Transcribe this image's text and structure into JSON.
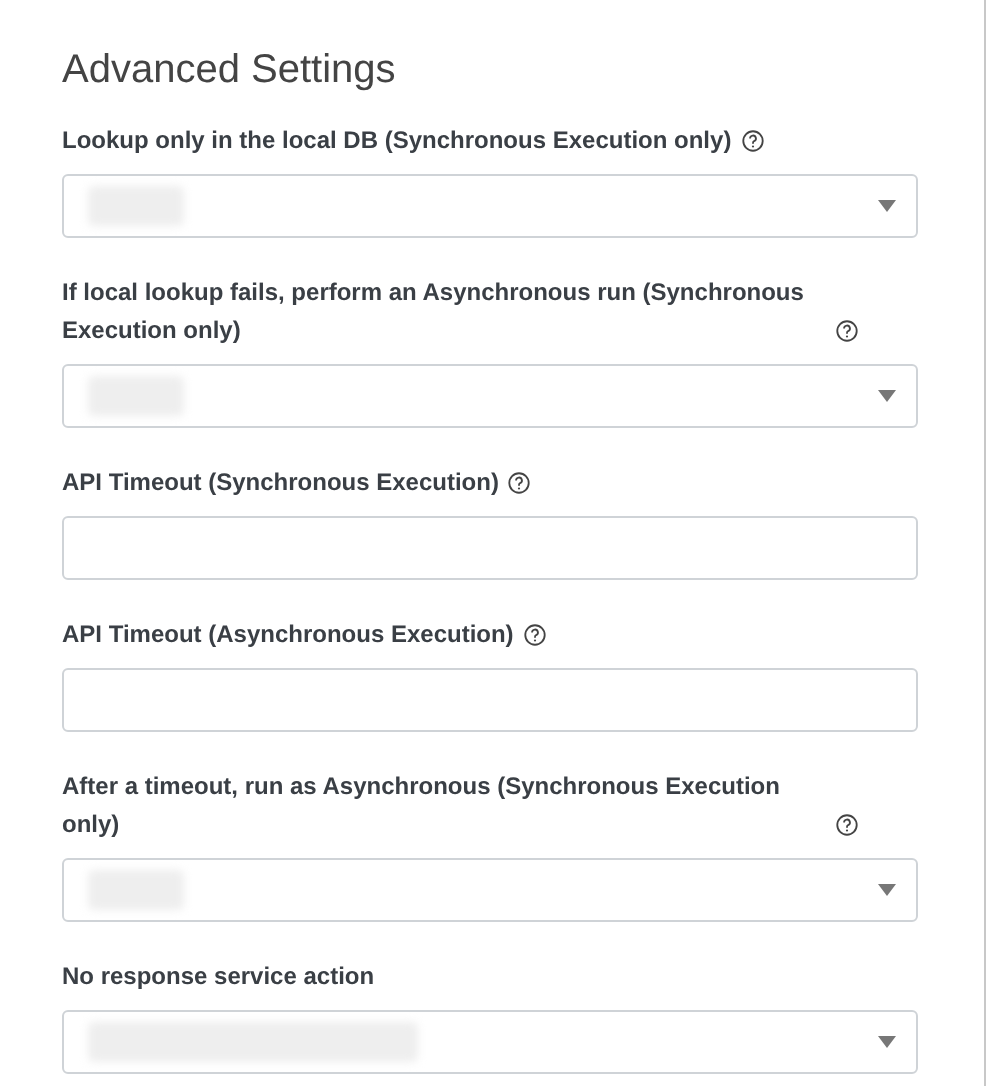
{
  "title": "Advanced Settings",
  "fields": [
    {
      "label": "Lookup only in the local DB (Synchronous Execution only)",
      "help": true,
      "kind": "select",
      "hidden_value": true
    },
    {
      "label": "If local lookup fails, perform an Asynchronous run (Synchronous Execution only)",
      "help": true,
      "kind": "select",
      "hidden_value": true
    },
    {
      "label": "API Timeout (Synchronous Execution)",
      "help": true,
      "kind": "text"
    },
    {
      "label": "API Timeout (Asynchronous Execution)",
      "help": true,
      "kind": "text"
    },
    {
      "label": "After a timeout, run as Asynchronous (Synchronous Execution only)",
      "help": true,
      "kind": "select",
      "hidden_value": true
    },
    {
      "label": "No response service action",
      "help": false,
      "kind": "select",
      "hidden_value": true
    }
  ]
}
